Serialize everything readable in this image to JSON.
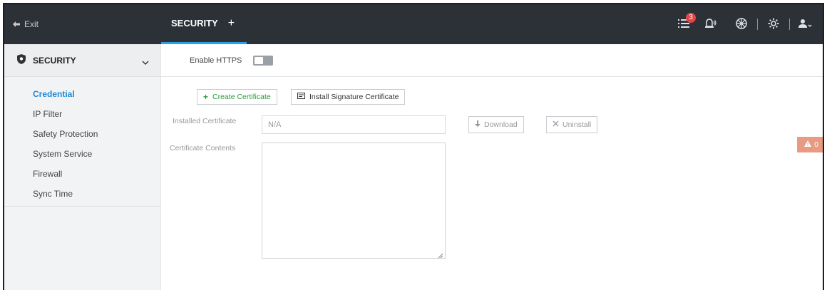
{
  "topbar": {
    "exit_label": "Exit",
    "tab_label": "SECURITY",
    "add_tab": "+",
    "notification_count": "3"
  },
  "sidebar": {
    "section_title": "SECURITY",
    "items": [
      {
        "label": "Credential",
        "active": true
      },
      {
        "label": "IP Filter",
        "active": false
      },
      {
        "label": "Safety Protection",
        "active": false
      },
      {
        "label": "System Service",
        "active": false
      },
      {
        "label": "Firewall",
        "active": false
      },
      {
        "label": "Sync Time",
        "active": false
      }
    ]
  },
  "main": {
    "enable_https_label": "Enable HTTPS",
    "enable_https_on": false,
    "create_certificate_label": "Create Certificate",
    "install_signature_label": "Install Signature Certificate",
    "installed_certificate_label": "Installed Certificate",
    "installed_certificate_value": "N/A",
    "download_label": "Download",
    "uninstall_label": "Uninstall",
    "certificate_contents_label": "Certificate Contents",
    "certificate_contents_value": ""
  },
  "alert": {
    "count": "0"
  },
  "colors": {
    "topbar_bg": "#2c3138",
    "accent_blue": "#1e88d6",
    "create_green": "#2c9a3d",
    "badge_red": "#e54545",
    "alert_orange": "#e89a82"
  }
}
